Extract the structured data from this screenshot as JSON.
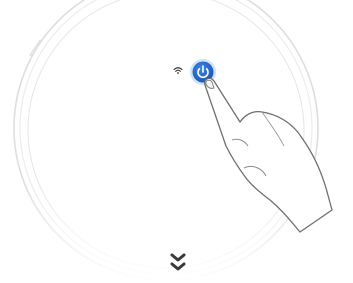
{
  "device": {
    "kind": "robot-vacuum-top",
    "body_color": "#ffffff",
    "outline_color": "#e3e3e3"
  },
  "power_button": {
    "icon": "power-icon",
    "color": "#1e63c4",
    "ring_color": "#7fb0e6",
    "state": "being-pressed"
  },
  "status_indicator": {
    "icon": "wifi-icon",
    "color": "#333333"
  },
  "gesture": {
    "icon": "pointing-hand-icon",
    "action": "press"
  },
  "scroll_hint": {
    "icon": "double-chevron-down-icon",
    "color": "#3a3a3a"
  }
}
